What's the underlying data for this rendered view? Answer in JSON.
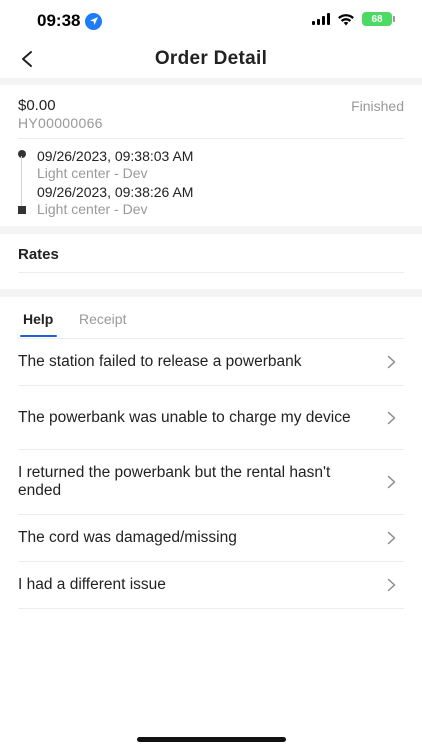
{
  "status_bar": {
    "time": "09:38",
    "battery": "68"
  },
  "header": {
    "title": "Order Detail"
  },
  "order": {
    "amount": "$0.00",
    "status": "Finished",
    "id": "HY00000066",
    "start_time": "09/26/2023, 09:38:03 AM",
    "start_location": "Light center - Dev",
    "end_time": "09/26/2023, 09:38:26 AM",
    "end_location": "Light center - Dev"
  },
  "rates": {
    "label": "Rates"
  },
  "tabs": [
    {
      "label": "Help",
      "active": true
    },
    {
      "label": "Receipt",
      "active": false
    }
  ],
  "help_items": [
    {
      "label": "The station failed to release a powerbank"
    },
    {
      "label": "The powerbank was unable to charge my device"
    },
    {
      "label": "I returned the powerbank but the rental hasn't ended"
    },
    {
      "label": "The cord was damaged/missing"
    },
    {
      "label": "I had a different issue"
    }
  ],
  "colors": {
    "accent": "#1e60d4",
    "muted_text": "#999999",
    "battery": "#4cd964",
    "location_icon": "#1e7cf5"
  }
}
